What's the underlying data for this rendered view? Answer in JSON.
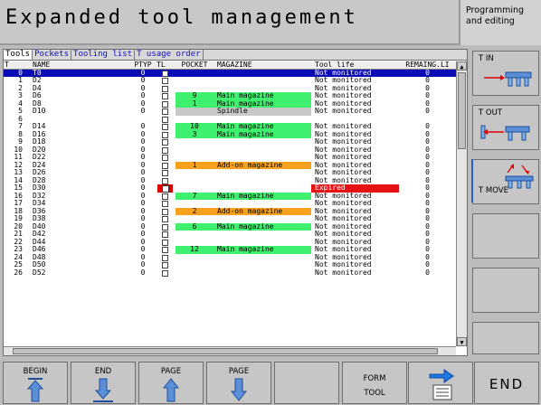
{
  "header": {
    "title": "Expanded tool management",
    "mode_line1": "Programming",
    "mode_line2": "and editing"
  },
  "tabs": [
    {
      "label": "Tools",
      "active": true
    },
    {
      "label": "Pockets",
      "active": false
    },
    {
      "label": "Tooling list",
      "active": false
    },
    {
      "label": "T usage order",
      "active": false
    }
  ],
  "columns": {
    "t": "T",
    "name": "NAME",
    "ptyp": "PTYP",
    "tl": "TL",
    "pocket": "POCKET",
    "magazine": "MAGAZINE",
    "life": "Tool life",
    "remaining": "REMAING.LI"
  },
  "rows": [
    {
      "t": "0",
      "name": "T0",
      "ptyp": "0",
      "tl": false,
      "pocket": "",
      "magazine": "",
      "life": "Not monitored",
      "rem": "0",
      "hl": "sel"
    },
    {
      "t": "1",
      "name": "D2",
      "ptyp": "0",
      "tl": false,
      "pocket": "",
      "magazine": "",
      "life": "Not monitored",
      "rem": "0",
      "hl": ""
    },
    {
      "t": "2",
      "name": "D4",
      "ptyp": "0",
      "tl": false,
      "pocket": "",
      "magazine": "",
      "life": "Not monitored",
      "rem": "0",
      "hl": ""
    },
    {
      "t": "3",
      "name": "D6",
      "ptyp": "0",
      "tl": false,
      "pocket": "9",
      "magazine": "Main magazine",
      "life": "Not monitored",
      "rem": "0",
      "hl": "green"
    },
    {
      "t": "4",
      "name": "D8",
      "ptyp": "0",
      "tl": false,
      "pocket": "1",
      "magazine": "Main magazine",
      "life": "Not monitored",
      "rem": "0",
      "hl": "green"
    },
    {
      "t": "5",
      "name": "D10",
      "ptyp": "0",
      "tl": false,
      "pocket": "",
      "magazine": "Spindle",
      "life": "Not monitored",
      "rem": "0",
      "hl": "grey"
    },
    {
      "t": "6",
      "name": "",
      "ptyp": "",
      "tl": false,
      "pocket": "",
      "magazine": "",
      "life": "",
      "rem": "",
      "hl": ""
    },
    {
      "t": "7",
      "name": "D14",
      "ptyp": "0",
      "tl": false,
      "pocket": "10",
      "magazine": "Main magazine",
      "life": "Not monitored",
      "rem": "0",
      "hl": "green"
    },
    {
      "t": "8",
      "name": "D16",
      "ptyp": "0",
      "tl": false,
      "pocket": "3",
      "magazine": "Main magazine",
      "life": "Not monitored",
      "rem": "0",
      "hl": "green"
    },
    {
      "t": "9",
      "name": "D18",
      "ptyp": "0",
      "tl": false,
      "pocket": "",
      "magazine": "",
      "life": "Not monitored",
      "rem": "0",
      "hl": ""
    },
    {
      "t": "10",
      "name": "D20",
      "ptyp": "0",
      "tl": false,
      "pocket": "",
      "magazine": "",
      "life": "Not monitored",
      "rem": "0",
      "hl": ""
    },
    {
      "t": "11",
      "name": "D22",
      "ptyp": "0",
      "tl": false,
      "pocket": "",
      "magazine": "",
      "life": "Not monitored",
      "rem": "0",
      "hl": ""
    },
    {
      "t": "12",
      "name": "D24",
      "ptyp": "0",
      "tl": false,
      "pocket": "1",
      "magazine": "Add-on magazine",
      "life": "Not monitored",
      "rem": "0",
      "hl": "orange"
    },
    {
      "t": "13",
      "name": "D26",
      "ptyp": "0",
      "tl": false,
      "pocket": "",
      "magazine": "",
      "life": "Not monitored",
      "rem": "0",
      "hl": ""
    },
    {
      "t": "14",
      "name": "D28",
      "ptyp": "0",
      "tl": false,
      "pocket": "",
      "magazine": "",
      "life": "Not monitored",
      "rem": "0",
      "hl": ""
    },
    {
      "t": "15",
      "name": "D30",
      "ptyp": "0",
      "tl": true,
      "pocket": "",
      "magazine": "",
      "life": "Expired",
      "rem": "0",
      "hl": "expired"
    },
    {
      "t": "16",
      "name": "D32",
      "ptyp": "0",
      "tl": false,
      "pocket": "7",
      "magazine": "Main magazine",
      "life": "Not monitored",
      "rem": "0",
      "hl": "green"
    },
    {
      "t": "17",
      "name": "D34",
      "ptyp": "0",
      "tl": false,
      "pocket": "",
      "magazine": "",
      "life": "Not monitored",
      "rem": "0",
      "hl": ""
    },
    {
      "t": "18",
      "name": "D36",
      "ptyp": "0",
      "tl": false,
      "pocket": "2",
      "magazine": "Add-on magazine",
      "life": "Not monitored",
      "rem": "0",
      "hl": "orange"
    },
    {
      "t": "19",
      "name": "D38",
      "ptyp": "0",
      "tl": false,
      "pocket": "",
      "magazine": "",
      "life": "Not monitored",
      "rem": "0",
      "hl": ""
    },
    {
      "t": "20",
      "name": "D40",
      "ptyp": "0",
      "tl": false,
      "pocket": "6",
      "magazine": "Main magazine",
      "life": "Not monitored",
      "rem": "0",
      "hl": "green"
    },
    {
      "t": "21",
      "name": "D42",
      "ptyp": "0",
      "tl": false,
      "pocket": "",
      "magazine": "",
      "life": "Not monitored",
      "rem": "0",
      "hl": ""
    },
    {
      "t": "22",
      "name": "D44",
      "ptyp": "0",
      "tl": false,
      "pocket": "",
      "magazine": "",
      "life": "Not monitored",
      "rem": "0",
      "hl": ""
    },
    {
      "t": "23",
      "name": "D46",
      "ptyp": "0",
      "tl": false,
      "pocket": "12",
      "magazine": "Main magazine",
      "life": "Not monitored",
      "rem": "0",
      "hl": "green"
    },
    {
      "t": "24",
      "name": "D48",
      "ptyp": "0",
      "tl": false,
      "pocket": "",
      "magazine": "",
      "life": "Not monitored",
      "rem": "0",
      "hl": ""
    },
    {
      "t": "25",
      "name": "D50",
      "ptyp": "0",
      "tl": false,
      "pocket": "",
      "magazine": "",
      "life": "Not monitored",
      "rem": "0",
      "hl": ""
    },
    {
      "t": "26",
      "name": "D52",
      "ptyp": "0",
      "tl": false,
      "pocket": "",
      "magazine": "",
      "life": "Not monitored",
      "rem": "0",
      "hl": ""
    }
  ],
  "sidebar": {
    "t_in": "T IN",
    "t_out": "T OUT",
    "t_move": "T MOVE"
  },
  "softkeys": {
    "begin": "BEGIN",
    "end": "END",
    "page_up": "PAGE",
    "page_down": "PAGE",
    "form_tool_1": "FORM",
    "form_tool_2": "TOOL",
    "end_main": "END"
  },
  "colors": {
    "selection": "#0b0bb5",
    "in_magazine": "#3ef06d",
    "add_on": "#f7a11c",
    "spindle": "#c8c8c8",
    "expired": "#e41212"
  }
}
